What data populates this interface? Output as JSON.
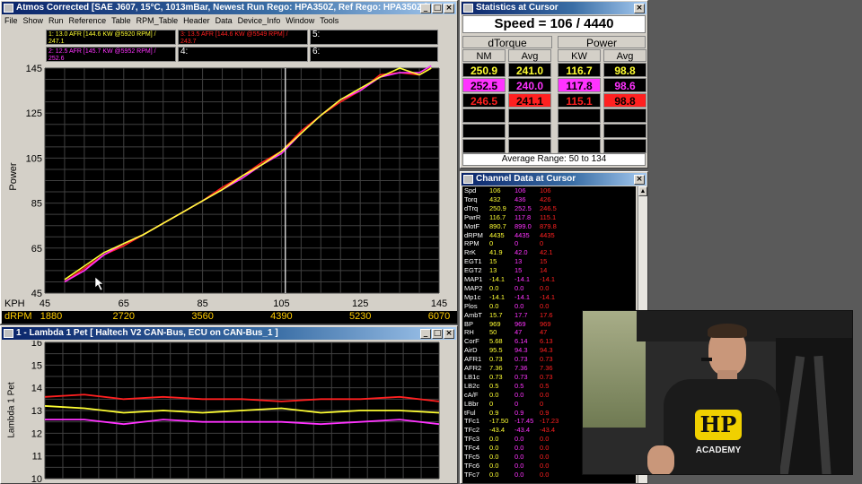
{
  "colors": {
    "red": "#ff2020",
    "yellow": "#ffff33",
    "magenta": "#ff33ff",
    "blue": "#7070ff",
    "grid": "#404040",
    "cursor": "#ffffff"
  },
  "power_window": {
    "title": "Atmos Corrected [SAE J607, 15°C, 1013mBar, Newest Run Rego: HPA350Z, Ref Rego: HPA350Z ]",
    "menu": [
      "File",
      "Show",
      "Run",
      "Reference",
      "Table",
      "RPM_Table",
      "Header",
      "Data",
      "Device_Info",
      "Window",
      "Tools"
    ],
    "legend": [
      {
        "num": "1:",
        "text": "13.0 AFR [144.6 KW @5920 RPM] / 247.1",
        "color": "#ffff33"
      },
      {
        "num": "2:",
        "text": "12.5 AFR [145.7 KW @5952 RPM] / 252.6",
        "color": "#ff33ff"
      },
      {
        "num": "3:",
        "text": "13.5 AFR [144.6 KW @5549 RPM] / 243.7",
        "color": "#ff2020"
      },
      {
        "num": "4:",
        "text": "",
        "color": "#ffffff"
      },
      {
        "num": "5:",
        "text": "",
        "color": "#ffffff"
      },
      {
        "num": "6:",
        "text": "",
        "color": "#ffffff"
      }
    ],
    "ylabel": "Power",
    "xunit": "KPH",
    "drpm_label": "dRPM",
    "y_ticks": [
      "145",
      "125",
      "105",
      "85",
      "65",
      "45"
    ],
    "x_ticks": [
      "45",
      "65",
      "85",
      "105",
      "125",
      "145"
    ],
    "drpm_ticks": [
      "1880",
      "2720",
      "3560",
      "4390",
      "5230",
      "6070"
    ]
  },
  "chart_data": [
    {
      "type": "line",
      "ylabel": "Power",
      "xlabel": "KPH",
      "xlim": [
        45,
        145
      ],
      "ylim": [
        45,
        145
      ],
      "grid": true,
      "x": [
        50,
        55,
        60,
        65,
        70,
        75,
        80,
        85,
        90,
        95,
        100,
        105,
        110,
        115,
        120,
        125,
        130,
        135,
        140,
        143
      ],
      "series": [
        {
          "name": "13.0 AFR [144.6 KW @5920 RPM] / 247.1",
          "color": "#ffff33",
          "values": [
            51,
            57,
            63,
            67,
            71,
            76,
            81,
            86,
            91,
            97,
            102,
            108,
            116,
            124,
            131,
            136,
            141,
            145,
            142,
            145
          ]
        },
        {
          "name": "12.5 AFR [145.7 KW @5952 RPM] / 252.6",
          "color": "#ff33ff",
          "values": [
            50,
            55,
            62,
            67,
            71,
            76,
            81,
            86,
            91,
            96,
            102,
            107,
            116,
            124,
            131,
            135,
            141,
            143,
            143,
            146
          ]
        },
        {
          "name": "13.5 AFR [144.6 KW @5549 RPM] / 243.7",
          "color": "#ff2020",
          "values": [
            50,
            56,
            62,
            66,
            71,
            76,
            81,
            86,
            92,
            97,
            103,
            108,
            117,
            124,
            130,
            135,
            142,
            143,
            142,
            145
          ]
        }
      ],
      "cursor_x": 106
    },
    {
      "type": "line",
      "ylabel": "Lambda 1 Pet",
      "ylim": [
        10,
        16
      ],
      "grid": true,
      "y_ticks": [
        "16",
        "15",
        "14",
        "13",
        "12",
        "11",
        "10"
      ],
      "x": [
        0,
        10,
        20,
        30,
        40,
        50,
        60,
        70,
        80,
        90,
        100
      ],
      "series": [
        {
          "name": "3",
          "color": "#ff2020",
          "values": [
            13.6,
            13.7,
            13.5,
            13.6,
            13.5,
            13.5,
            13.4,
            13.5,
            13.5,
            13.6,
            13.4
          ]
        },
        {
          "name": "1",
          "color": "#ffff33",
          "values": [
            13.2,
            13.1,
            12.9,
            13.0,
            12.9,
            13.0,
            13.1,
            12.9,
            13.0,
            13.0,
            12.9
          ]
        },
        {
          "name": "2",
          "color": "#ff33ff",
          "values": [
            12.6,
            12.6,
            12.4,
            12.6,
            12.5,
            12.5,
            12.5,
            12.4,
            12.5,
            12.6,
            12.4
          ]
        }
      ]
    }
  ],
  "lambda_window": {
    "title": "1 - Lambda 1 Pet      [ Haltech V2 CAN-Bus, ECU on CAN-Bus_1 ]",
    "ylabel": "Lambda 1 Pet",
    "y_ticks": [
      "16",
      "15",
      "14",
      "13",
      "12",
      "11",
      "10"
    ]
  },
  "stats_window": {
    "title": "Statistics at Cursor",
    "speed": "Speed = 106 / 4440",
    "group1": "dTorque",
    "group2": "Power",
    "cols": [
      "NM",
      "Avg",
      "KW",
      "Avg"
    ],
    "rows": [
      {
        "vals": [
          "250.9",
          "241.0",
          "116.7",
          "98.8"
        ],
        "fg": "#ffff33",
        "bg": "#000000"
      },
      {
        "vals": [
          "252.5",
          "240.0",
          "117.8",
          "98.6"
        ],
        "fg": "#ff33ff",
        "bg": "#000000"
      },
      {
        "vals": [
          "246.5",
          "241.1",
          "115.1",
          "98.8"
        ],
        "fg": "#ff2020",
        "bg": "#000000"
      }
    ],
    "avg_range": "Average Range: 50 to 134"
  },
  "channel_window": {
    "title": "Channel Data at Cursor",
    "rows": [
      [
        "Spd",
        "106",
        "106",
        "106"
      ],
      [
        "Torq",
        "432",
        "436",
        "426"
      ],
      [
        "dTrq",
        "250.9",
        "252.5",
        "246.5"
      ],
      [
        "PwrR",
        "116.7",
        "117.8",
        "115.1"
      ],
      [
        "MotF",
        "890.7",
        "899.0",
        "879.8"
      ],
      [
        "dRPM",
        "4435",
        "4435",
        "4435"
      ],
      [
        "RPM",
        "0",
        "0",
        "0"
      ],
      [
        "RrK",
        "41.9",
        "42.0",
        "42.1"
      ],
      [
        "EGT1",
        "15",
        "13",
        "15"
      ],
      [
        "EGT2",
        "13",
        "15",
        "14"
      ],
      [
        "MAP1",
        "-14.1",
        "-14.1",
        "-14.1"
      ],
      [
        "MAP2",
        "0.0",
        "0.0",
        "0.0"
      ],
      [
        "Mp1c",
        "-14.1",
        "-14.1",
        "-14.1"
      ],
      [
        "Plos",
        "0.0",
        "0.0",
        "0.0"
      ],
      [
        "AmbT",
        "15.7",
        "17.7",
        "17.6"
      ],
      [
        "BP",
        "969",
        "969",
        "969"
      ],
      [
        "RH",
        "50",
        "47",
        "47"
      ],
      [
        "CorF",
        "5.68",
        "6.14",
        "6.13"
      ],
      [
        "AirD",
        "95.5",
        "94.3",
        "94.3"
      ],
      [
        "AFR1",
        "0.73",
        "0.73",
        "0.73"
      ],
      [
        "AFR2",
        "7.36",
        "7.36",
        "7.36"
      ],
      [
        "LB1c",
        "0.73",
        "0.73",
        "0.73"
      ],
      [
        "LB2c",
        "0.5",
        "0.5",
        "0.5"
      ],
      [
        "cA/F",
        "0.0",
        "0.0",
        "0.0"
      ],
      [
        "LBbr",
        "0",
        "0",
        "0"
      ],
      [
        "tFul",
        "0.9",
        "0.9",
        "0.9"
      ],
      [
        "TFc1",
        "-17.50",
        "-17.45",
        "-17.23"
      ],
      [
        "TFc2",
        "-43.4",
        "-43.4",
        "-43.4"
      ],
      [
        "TFc3",
        "0.0",
        "0.0",
        "0.0"
      ],
      [
        "TFc4",
        "0.0",
        "0.0",
        "0.0"
      ],
      [
        "TFc5",
        "0.0",
        "0.0",
        "0.0"
      ],
      [
        "TFc6",
        "0.0",
        "0.0",
        "0.0"
      ],
      [
        "TFc7",
        "0.0",
        "0.0",
        "0.0"
      ]
    ]
  },
  "webcam": {
    "shirt_logo": "HP",
    "shirt_text": "ACADEMY"
  }
}
